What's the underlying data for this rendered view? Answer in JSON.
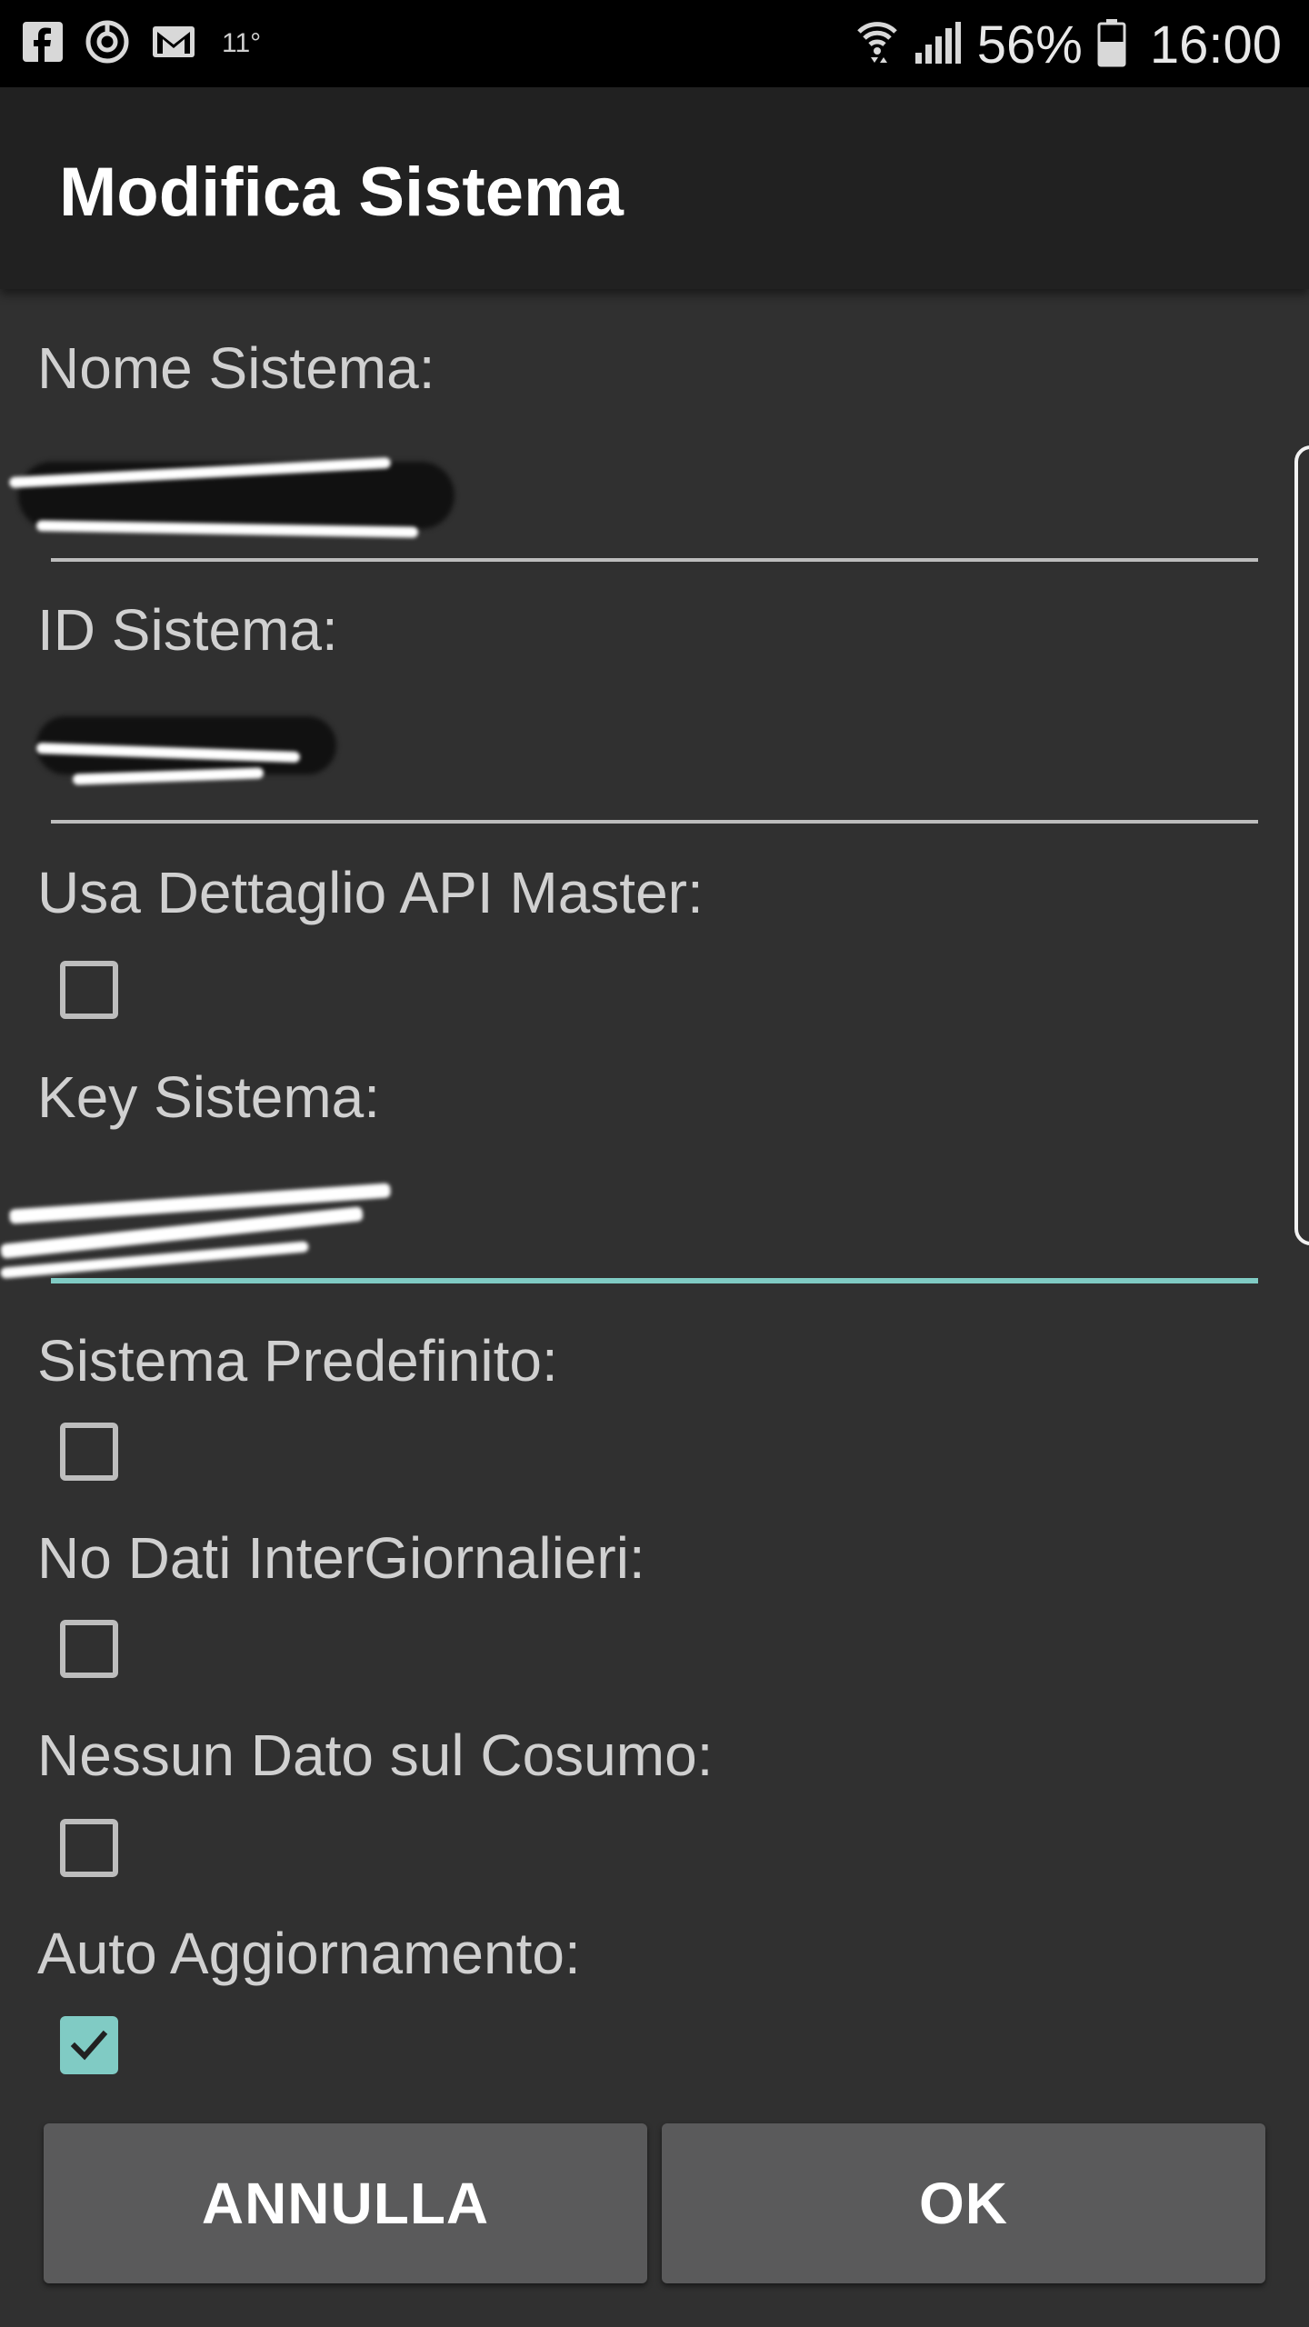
{
  "status_bar": {
    "icons": [
      "facebook-icon",
      "sync-icon",
      "gmail-icon"
    ],
    "temperature": "11°",
    "battery_percent": "56%",
    "time": "16:00"
  },
  "app_bar": {
    "title": "Modifica Sistema"
  },
  "form": {
    "nome_sistema": {
      "label": "Nome Sistema:",
      "value": ""
    },
    "id_sistema": {
      "label": "ID Sistema:",
      "value": ""
    },
    "usa_dettaglio_api_master": {
      "label": "Usa Dettaglio API Master:",
      "checked": false
    },
    "key_sistema": {
      "label": "Key Sistema:",
      "value": ""
    },
    "sistema_predefinito": {
      "label": "Sistema Predefinito:",
      "checked": false
    },
    "no_dati_intergiornalieri": {
      "label": "No Dati InterGiornalieri:",
      "checked": false
    },
    "nessun_dato_cosumo": {
      "label": "Nessun Dato sul Cosumo:",
      "checked": false
    },
    "auto_aggiornamento": {
      "label": "Auto Aggiornamento:",
      "checked": true
    }
  },
  "buttons": {
    "cancel": "ANNULLA",
    "ok": "OK"
  },
  "colors": {
    "background": "#303030",
    "app_bar": "#212121",
    "accent": "#80cbc4",
    "button": "#5a5a5b"
  }
}
